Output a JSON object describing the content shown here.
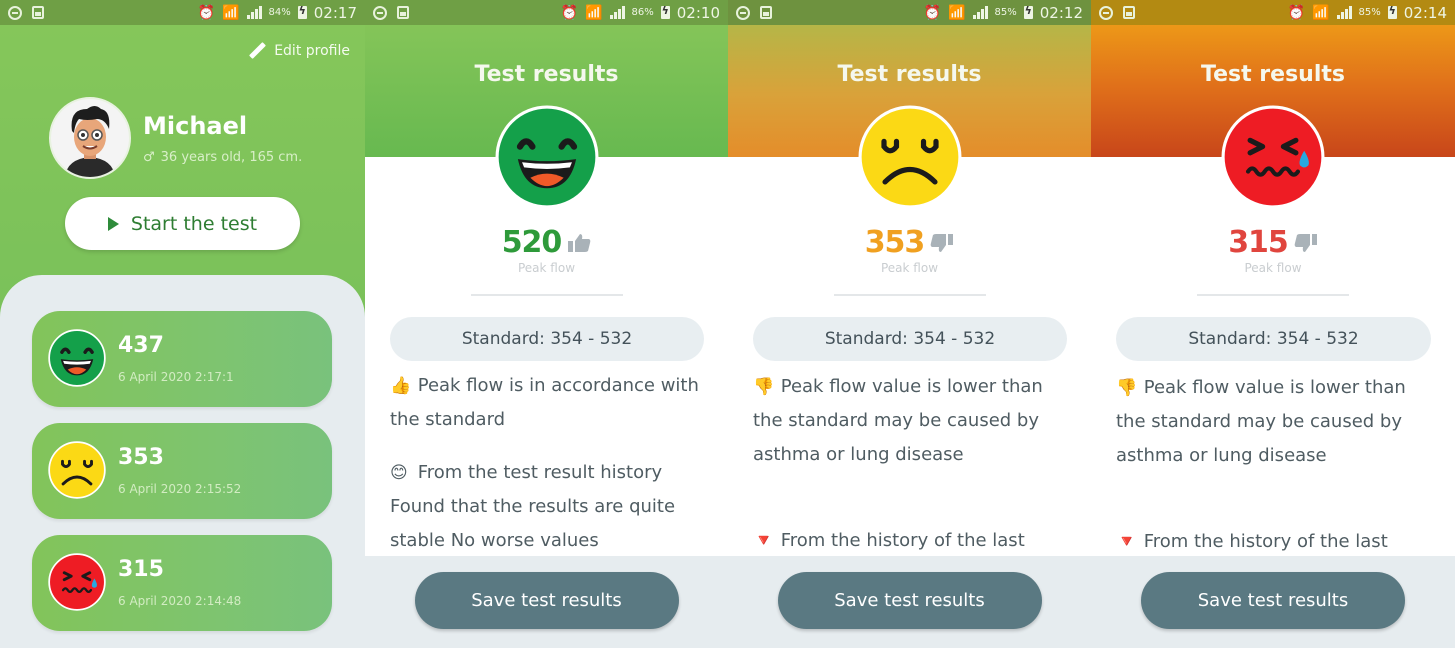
{
  "screens": {
    "profile": {
      "status": {
        "battery": "84%",
        "time": "02:17"
      },
      "edit_profile": "Edit profile",
      "name": "Michael",
      "gender_symbol": "♂",
      "info": "36 years old, 165 cm.",
      "start_button": "Start the test",
      "history": [
        {
          "value": "437",
          "date": "6 April 2020 2:17:1",
          "mood": "happy"
        },
        {
          "value": "353",
          "date": "6 April 2020 2:15:52",
          "mood": "sad"
        },
        {
          "value": "315",
          "date": "6 April 2020 2:14:48",
          "mood": "distressed"
        }
      ]
    },
    "result_good": {
      "status": {
        "battery": "86%",
        "time": "02:10"
      },
      "title": "Test results",
      "score": "520",
      "score_color": "#2e9a3a",
      "verdict_icon": "thumbs-up",
      "peak_label": "Peak flow",
      "standard": "Standard: 354 - 532",
      "messages": [
        {
          "emoji": "👍",
          "text": "Peak flow is in accordance with the standard"
        },
        {
          "emoji": "😊",
          "text": "From the test result history Found that the results are quite stable No worse values"
        }
      ],
      "save_button": "Save test results"
    },
    "result_medium": {
      "status": {
        "battery": "85%",
        "time": "02:12"
      },
      "title": "Test results",
      "score": "353",
      "score_color": "#f0a020",
      "verdict_icon": "thumbs-down",
      "peak_label": "Peak flow",
      "standard": "Standard: 354 - 532",
      "messages": [
        {
          "emoji": "👎",
          "text": "Peak flow value is lower than the standard may be caused by asthma or lung disease"
        },
        {
          "emoji": "🔻",
          "text": "From the history of the last"
        }
      ],
      "save_button": "Save test results"
    },
    "result_bad": {
      "status": {
        "battery": "85%",
        "time": "02:14"
      },
      "title": "Test results",
      "score": "315",
      "score_color": "#e0453e",
      "verdict_icon": "thumbs-down",
      "peak_label": "Peak flow",
      "standard": "Standard: 354 - 532",
      "messages": [
        {
          "emoji": "👎",
          "text": "Peak flow value is lower than the standard may be caused by asthma or lung disease"
        },
        {
          "emoji": "🔻",
          "text": "From the history of the last"
        }
      ],
      "save_button": "Save test results"
    }
  },
  "colors": {
    "green_face": "#14a04a",
    "yellow_face": "#fbd915",
    "red_face": "#ee1c24",
    "button_dark": "#5a7982",
    "panel_grey": "#e6ecef"
  }
}
